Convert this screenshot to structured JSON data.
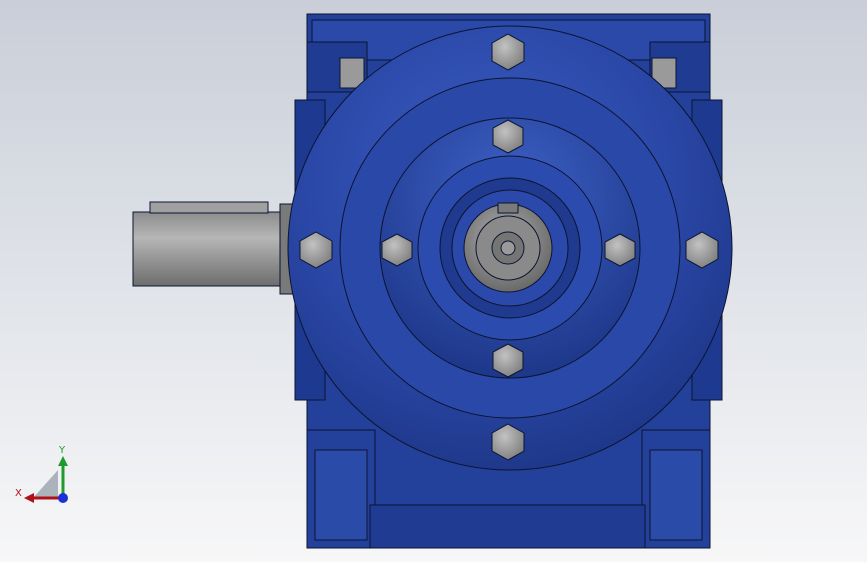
{
  "viewport": {
    "model": "worm-gearbox",
    "colors": {
      "background_top": "#c9ced8",
      "background_bottom": "#f7f7f8",
      "housing": "#23409a",
      "housing_dark": "#142a66",
      "housing_light": "#3556b8",
      "outline": "#0b1430",
      "steel": "#9a9a9a",
      "steel_dark": "#6e6e6e",
      "bolt": "#a8a8a8"
    }
  },
  "triad": {
    "x_label": "X",
    "y_label": "Y",
    "colors": {
      "x": "#b0121a",
      "y": "#1f9a2e",
      "z": "#1d2fd6"
    }
  }
}
